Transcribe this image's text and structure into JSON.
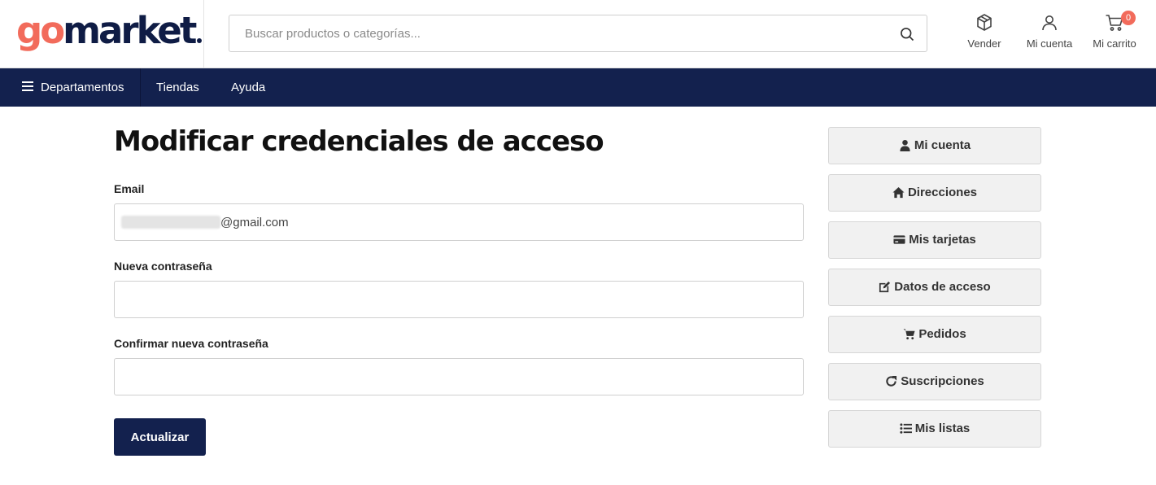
{
  "brand": {
    "logo_part1": "go",
    "logo_part2": "market"
  },
  "search": {
    "placeholder": "Buscar productos o categorías..."
  },
  "header_actions": [
    {
      "label": "Vender",
      "icon": "box-icon"
    },
    {
      "label": "Mi cuenta",
      "icon": "user-icon"
    },
    {
      "label": "Mi carrito",
      "icon": "cart-icon",
      "badge": "0"
    }
  ],
  "nav": {
    "departments": "Departamentos",
    "stores": "Tiendas",
    "help": "Ayuda"
  },
  "page": {
    "title": "Modificar credenciales de acceso",
    "email_label": "Email",
    "email_value": "@gmail.com",
    "new_password_label": "Nueva contraseña",
    "new_password_value": "",
    "confirm_password_label": "Confirmar nueva contraseña",
    "confirm_password_value": "",
    "submit_label": "Actualizar"
  },
  "sidebar": [
    {
      "label": "Mi cuenta",
      "icon": "user-icon"
    },
    {
      "label": "Direcciones",
      "icon": "home-icon"
    },
    {
      "label": "Mis tarjetas",
      "icon": "credit-card-icon"
    },
    {
      "label": "Datos de acceso",
      "icon": "edit-icon"
    },
    {
      "label": "Pedidos",
      "icon": "cart-icon"
    },
    {
      "label": "Suscripciones",
      "icon": "refresh-icon"
    },
    {
      "label": "Mis listas",
      "icon": "list-icon"
    }
  ],
  "colors": {
    "brand_orange": "#f26b5b",
    "navy": "#13214e"
  }
}
